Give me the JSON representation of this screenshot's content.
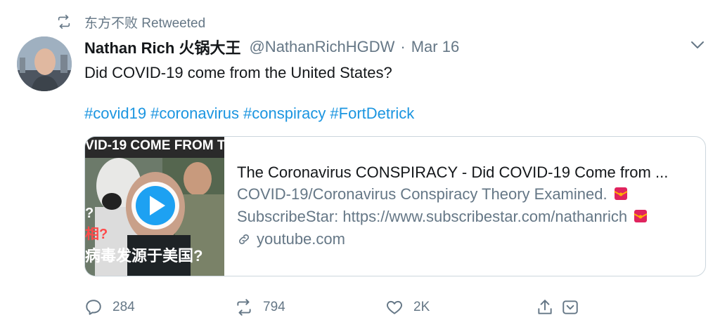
{
  "retweet": {
    "user": "东方不败",
    "label": "Retweeted",
    "icon": "retweet-icon"
  },
  "tweet": {
    "author_name": "Nathan Rich 火锅大王",
    "handle": "@NathanRichHGDW",
    "separator": "·",
    "date": "Mar 16",
    "text": "Did COVID-19 come from the United States?",
    "hashtags": [
      "#covid19",
      "#coronavirus",
      "#conspiracy",
      "#FortDetrick"
    ]
  },
  "card": {
    "thumb_banner": "VID-19 COME FROM T",
    "thumb_caption_line1": "?",
    "thumb_caption_line2": "相?",
    "thumb_caption_line3": "病毒发源于美国?",
    "title": "The Coronavirus CONSPIRACY - Did COVID-19 Come from ...",
    "desc_line1": "COVID-19/Coronavirus Conspiracy Theory Examined.",
    "desc_line2": "SubscribeStar: https://www.subscribestar.com/nathanrich",
    "domain": "youtube.com"
  },
  "actions": {
    "replies": "284",
    "retweets": "794",
    "likes": "2K"
  },
  "colors": {
    "link": "#1b95e0",
    "muted": "#657786",
    "border": "#ccd6dd",
    "play": "#1da1f2"
  }
}
